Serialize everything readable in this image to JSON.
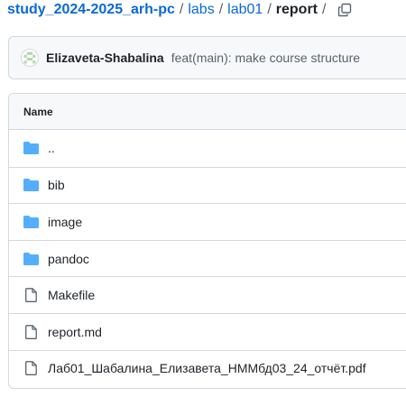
{
  "breadcrumb": {
    "repo": "study_2024-2025_arh-pc",
    "separator": "/",
    "parts": [
      "labs",
      "lab01"
    ],
    "current": "report"
  },
  "commit": {
    "author": "Elizaveta-Shabalina",
    "message": "feat(main): make course structure"
  },
  "table": {
    "header": "Name",
    "rows": [
      {
        "name": "..",
        "icon": "folder-icon"
      },
      {
        "name": "bib",
        "icon": "folder-icon"
      },
      {
        "name": "image",
        "icon": "folder-icon"
      },
      {
        "name": "pandoc",
        "icon": "folder-icon"
      },
      {
        "name": "Makefile",
        "icon": "file-icon"
      },
      {
        "name": "report.md",
        "icon": "file-icon"
      },
      {
        "name": "Лаб01_Шабалина_Елизавета_НММбд03_24_отчёт.pdf",
        "icon": "file-icon"
      }
    ]
  },
  "colors": {
    "link": "#0969da",
    "folder": "#54aeff",
    "border": "#d1d9e0",
    "header_bg": "#f6f8fa",
    "muted": "#59636e"
  }
}
